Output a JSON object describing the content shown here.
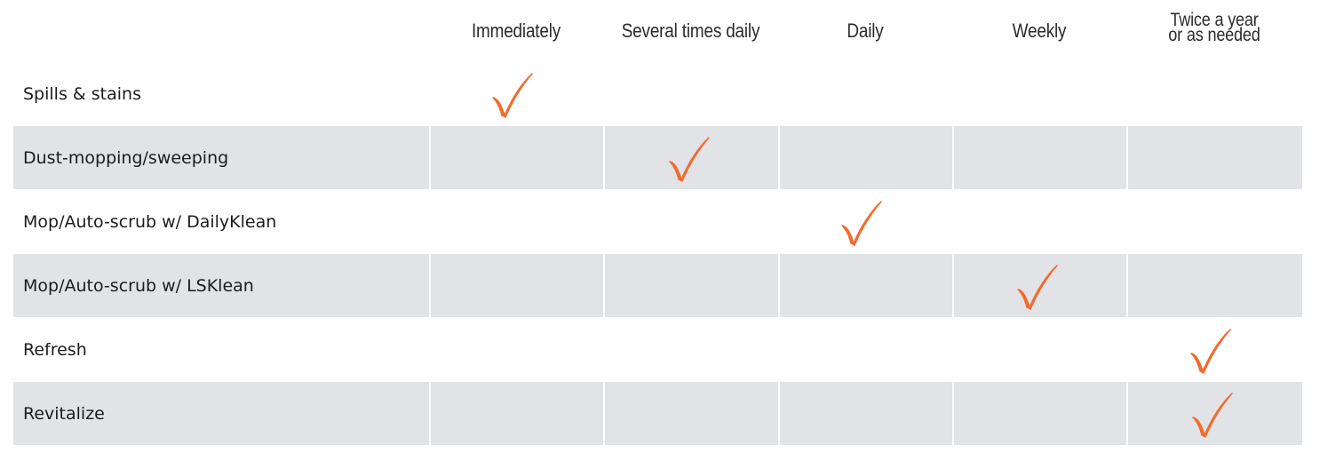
{
  "columns": [
    "Immediately",
    "Several times daily",
    "Daily",
    "Weekly",
    [
      "Twice a year",
      "or as needed"
    ]
  ],
  "rows": [
    {
      "label": "Spills & stains",
      "check_column": 0
    },
    {
      "label": "Dust-mopping/sweeping",
      "check_column": 1
    },
    {
      "label": "Mop/Auto-scrub w/ DailyKlean",
      "check_column": 2
    },
    {
      "label": "Mop/Auto-scrub w/ LSKlean",
      "check_column": 3
    },
    {
      "label": "Refresh",
      "check_column": 4
    },
    {
      "label": "Revitalize",
      "check_column": 4
    }
  ],
  "colors": {
    "check": "#f26a2e",
    "shade": "#e1e3e6"
  },
  "icons": {
    "check": "checkmark-icon"
  }
}
